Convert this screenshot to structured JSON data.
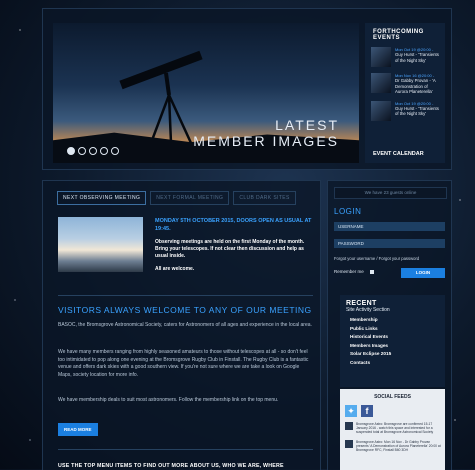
{
  "hero": {
    "slide_title_line1": "LATEST",
    "slide_title_line2": "MEMBER IMAGES",
    "events_heading": "FORTHCOMING EVENTS",
    "events": [
      {
        "date": "Mon Oct 19 @20:00 -",
        "title": "Guy Hurst - 'Transients of the Night Sky'"
      },
      {
        "date": "Mon Nov 16 @20:00 -",
        "title": "Dr Gabby Provan - 'A Demonstration of Aurora Planeterella'"
      },
      {
        "date": "Mon Oct 19 @20:00 -",
        "title": "Guy Hurst - 'Transients of the Night Sky'"
      }
    ],
    "calendar_label": "EVENT CALENDAR"
  },
  "main": {
    "tabs": [
      "NEXT OBSERVING MEETING",
      "NEXT FORMAL MEETING",
      "CLUB DARK SITES"
    ],
    "meeting_heading": "MONDAY 5TH OCTOBER 2015, DOORS OPEN AS USUAL AT 19:45.",
    "meeting_p1": "Observing meetings are held on the first Monday of the month. Bring your telescopes. If not clear then discussion and help as usual inside.",
    "meeting_p2": "All are welcome.",
    "visitors_heading": "VISITORS ALWAYS WELCOME TO ANY OF OUR MEETING",
    "intro": "BASOC, the Bromsgrove Astronomical Society, caters for Astronomers of all ages and experience in the local area.",
    "para1": "We have many members ranging from highly seasoned amateurs to those without telescopes at all - so don't feel too intimidated to pop along one evening at the Bromsgrove Rugby Club in Finstall. The Rugby Club is a fantastic venue and offers dark skies with a good southern view. If you're not sure where we are take a look on Google Maps, society location for more info.",
    "para2": "We have membership deals to suit most astronomers. Follow the membership link on the top menu.",
    "read_more": "READ MORE",
    "bottom_heading": "USE THE TOP MENU ITEMS TO FIND OUT MORE ABOUT US, WHO WE ARE, WHERE"
  },
  "sidebar": {
    "online": "We have 23 guests online",
    "login_heading": "LOGIN",
    "username_placeholder": "USERNAME",
    "password_placeholder": "PASSWORD",
    "forgot": "Forgot your username / Forgot your password",
    "remember": "Remember me",
    "login_button": "LOGIN",
    "recent_heading": "RECENT",
    "recent_sub": "Site Activity Section",
    "recent_items": [
      "Membership",
      "Public Links",
      "Historical Events",
      "Members Images",
      "Solar Eclipse 2015",
      "Contacts"
    ],
    "social_heading": "SOCIAL FEEDS",
    "tweets": [
      "Bromsgrove Astro: Bromsgrove are confirmed 15-17 January 2016 - watch this space and interested for a suspended total at Bromsgrove Astronomical Society",
      "Bromsgrove Astro: Mon 16 Nov - Dr Gabby Provan presents 'A Demonstration of Aurora Planeterella' 20:00 at Bromsgrove RFC, Finstall B60 3DH"
    ]
  }
}
